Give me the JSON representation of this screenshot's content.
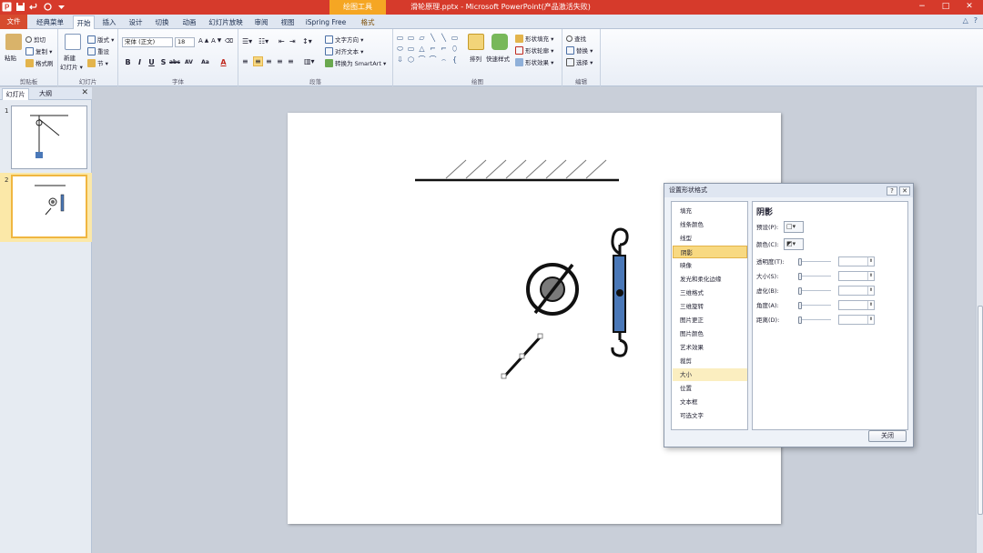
{
  "titlebar": {
    "context_tab": "绘图工具",
    "title": "滑轮原理.pptx - Microsoft PowerPoint(产品激活失败)",
    "controls": [
      "−",
      "□",
      "✕"
    ]
  },
  "qat_icons": [
    "powerpoint-logo-icon",
    "save-icon",
    "undo-icon",
    "redo-icon",
    "customize-icon"
  ],
  "tabs": [
    {
      "label": "文件"
    },
    {
      "label": "经典菜单"
    },
    {
      "label": "开始"
    },
    {
      "label": "插入"
    },
    {
      "label": "设计"
    },
    {
      "label": "切换"
    },
    {
      "label": "动画"
    },
    {
      "label": "幻灯片放映"
    },
    {
      "label": "审阅"
    },
    {
      "label": "视图"
    },
    {
      "label": "iSpring Free"
    },
    {
      "label": "格式"
    }
  ],
  "ribbon": {
    "clipboard": {
      "label": "剪贴板",
      "paste": "粘贴",
      "cut": "剪切",
      "copy": "复制 ▾",
      "format_painter": "格式刷"
    },
    "slides": {
      "label": "幻灯片",
      "new_slide": "新建",
      "new_slide_sub": "幻灯片 ▾",
      "layout": "版式 ▾",
      "reset": "重设",
      "section": "节 ▾"
    },
    "font": {
      "label": "字体",
      "font_name": "宋体 (正文)",
      "font_size": "18",
      "buttons": [
        "B",
        "I",
        "U",
        "S",
        "abc",
        "AV",
        "Aa",
        "A"
      ]
    },
    "paragraph": {
      "label": "段落",
      "text_direction": "文字方向 ▾",
      "align_text": "对齐文本 ▾",
      "smartart": "转换为 SmartArt ▾"
    },
    "drawing": {
      "label": "绘图",
      "arrange": "排列",
      "quick_styles": "快速样式",
      "shape_fill": "形状填充 ▾",
      "shape_outline": "形状轮廓 ▾",
      "shape_effects": "形状效果 ▾",
      "shapes": [
        "▭",
        "▭",
        "▱",
        "╲",
        "╲",
        "▭",
        "⬭",
        "▭",
        "△",
        "⌐",
        "⌐",
        "⬯",
        "⇩",
        "⬡",
        "⌒",
        "⌒",
        "⌢",
        "{"
      ]
    },
    "editing": {
      "label": "编辑",
      "find": "查找",
      "replace": "替换 ▾",
      "select": "选择 ▾"
    }
  },
  "panel": {
    "tabs": [
      "幻灯片",
      "大纲"
    ],
    "close": "✕",
    "slides": [
      {
        "number": "1"
      },
      {
        "number": "2"
      }
    ]
  },
  "dialog": {
    "title": "设置形状格式",
    "title_buttons": [
      "?",
      "✕"
    ],
    "categories": [
      {
        "label": "填充",
        "state": "normal"
      },
      {
        "label": "线条颜色",
        "state": "normal"
      },
      {
        "label": "线型",
        "state": "normal"
      },
      {
        "label": "阴影",
        "state": "selected"
      },
      {
        "label": "映像",
        "state": "normal"
      },
      {
        "label": "发光和柔化边缘",
        "state": "normal"
      },
      {
        "label": "三维格式",
        "state": "normal"
      },
      {
        "label": "三维旋转",
        "state": "normal"
      },
      {
        "label": "图片更正",
        "state": "normal"
      },
      {
        "label": "图片颜色",
        "state": "normal"
      },
      {
        "label": "艺术效果",
        "state": "normal"
      },
      {
        "label": "裁剪",
        "state": "normal"
      },
      {
        "label": "大小",
        "state": "hover"
      },
      {
        "label": "位置",
        "state": "normal"
      },
      {
        "label": "文本框",
        "state": "normal"
      },
      {
        "label": "可选文字",
        "state": "normal"
      }
    ],
    "heading": "阴影",
    "preset_label": "预设(P):",
    "color_label": "颜色(C):",
    "sliders": [
      {
        "label": "透明度(T):"
      },
      {
        "label": "大小(S):"
      },
      {
        "label": "虚化(B):"
      },
      {
        "label": "角度(A):"
      },
      {
        "label": "距离(D):"
      }
    ],
    "close_button": "关闭"
  },
  "colors": {
    "titlebar": "#d63a2b",
    "context_tab": "#f5a623",
    "spring_fill": "#4a78b8",
    "selected_item": "#f8d981"
  }
}
